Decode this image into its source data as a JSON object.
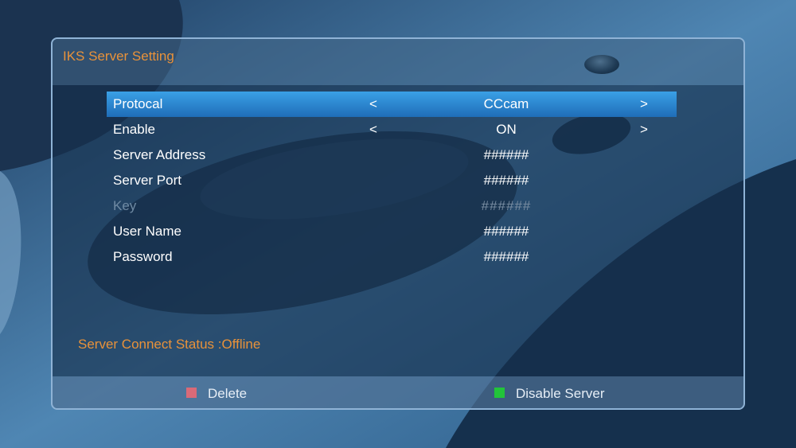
{
  "title": "IKS Server Setting",
  "rows": [
    {
      "label": "Protocal",
      "value": "CCcam",
      "left_arrow": "<",
      "right_arrow": ">"
    },
    {
      "label": "Enable",
      "value": "ON",
      "left_arrow": "<",
      "right_arrow": ">"
    },
    {
      "label": "Server Address",
      "value": "######"
    },
    {
      "label": "Server Port",
      "value": "######"
    },
    {
      "label": "Key",
      "value": "######"
    },
    {
      "label": "User Name",
      "value": "######"
    },
    {
      "label": "Password",
      "value": "######"
    }
  ],
  "status": "Server Connect Status :Offline",
  "footer": {
    "delete_label": "Delete",
    "delete_color": "#d96a78",
    "disable_label": "Disable Server",
    "disable_color": "#22c43a"
  },
  "colors": {
    "accent": "#e8923a",
    "selected_row": "#2a86d0"
  }
}
